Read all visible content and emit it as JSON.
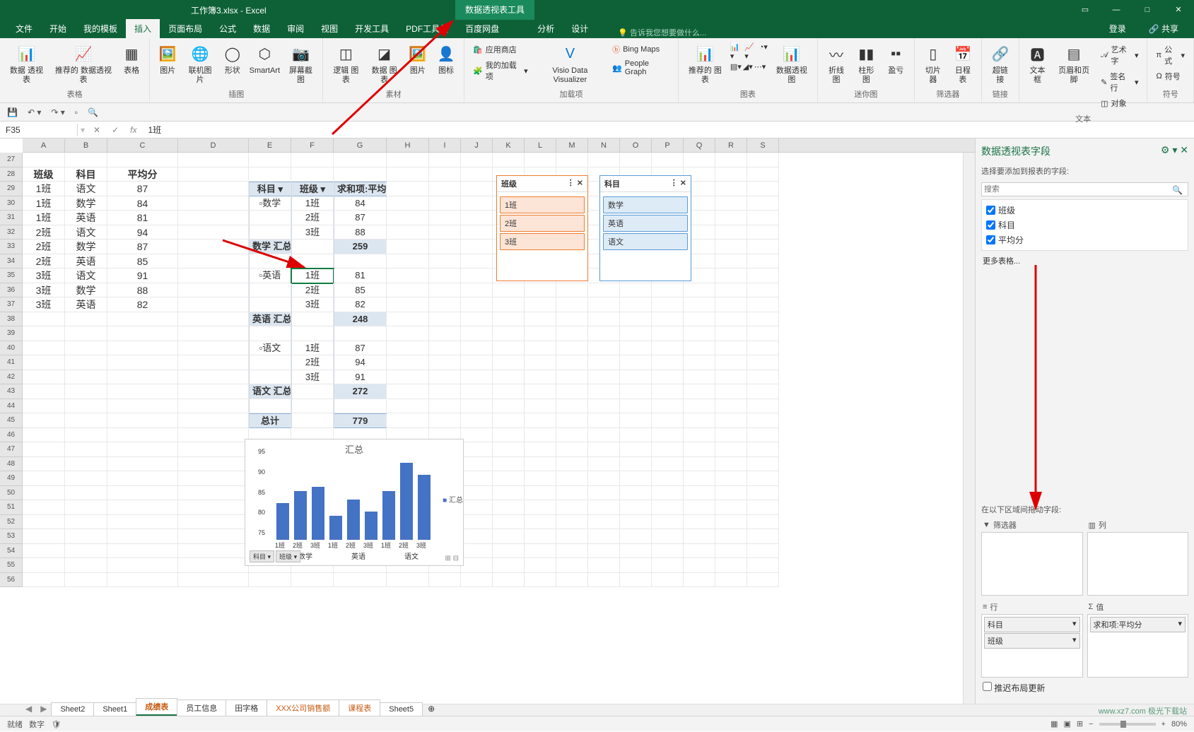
{
  "title_bar": {
    "doc": "工作簿3.xlsx - Excel",
    "context_tab": "数据透视表工具"
  },
  "win_controls": {
    "ribbon_opts": "▭",
    "min": "—",
    "max": "□",
    "close": "✕"
  },
  "tabs": {
    "file": "文件",
    "home": "开始",
    "templates": "我的模板",
    "insert": "插入",
    "layout": "页面布局",
    "formulas": "公式",
    "data": "数据",
    "review": "审阅",
    "view": "视图",
    "dev": "开发工具",
    "pdf": "PDF工具集",
    "baidu": "百度网盘",
    "analyze": "分析",
    "design": "设计",
    "tell": "告诉我您想要做什么...",
    "login": "登录",
    "share": "共享"
  },
  "ribbon": {
    "tables": {
      "pivot": "数据\n透视表",
      "rec_pivot": "推荐的\n数据透视表",
      "table": "表格",
      "label": "表格"
    },
    "illus": {
      "pic": "图片",
      "online": "联机图片",
      "shapes": "形状",
      "smartart": "SmartArt",
      "screenshot": "屏幕截图",
      "label": "插图"
    },
    "charts": {
      "reccharts": "推荐的\n图表",
      "pivotchart": "数据透视图",
      "label": "图表"
    },
    "addins": {
      "store": "应用商店",
      "myaddins": "我的加载项",
      "vdv": "Visio Data\nVisualizer",
      "bing": "Bing Maps",
      "pgraph": "People Graph",
      "label": "加载项"
    },
    "sparkline": {
      "line": "折线图",
      "col": "柱形图",
      "winloss": "盈亏",
      "label": "迷你图"
    },
    "filters": {
      "slicer": "切片器",
      "timeline": "日程表",
      "label": "筛选器"
    },
    "links": {
      "link": "超链接",
      "label": "链接"
    },
    "text": {
      "tbox": "文本框",
      "hdrftr": "页眉和页脚",
      "wordart": "艺术字",
      "sig": "签名行",
      "obj": "对象",
      "label": "文本"
    },
    "symbols": {
      "eq": "公式",
      "sym": "符号",
      "label": "符号"
    },
    "logic": {
      "logicmodel": "逻辑\n图表",
      "datamodel": "数据\n图表",
      "pic2": "图片",
      "icons": "图标",
      "label": "素材"
    }
  },
  "namebox": "F35",
  "formula": "1班",
  "cols": [
    "A",
    "B",
    "C",
    "D",
    "E",
    "F",
    "G",
    "H",
    "I",
    "J",
    "K",
    "L",
    "M",
    "N",
    "O",
    "P",
    "Q",
    "R",
    "S"
  ],
  "row_start": 27,
  "row_end": 56,
  "source_table": {
    "headers": {
      "class": "班级",
      "subject": "科目",
      "avg": "平均分"
    },
    "rows": [
      {
        "c": "1班",
        "s": "语文",
        "v": "87"
      },
      {
        "c": "1班",
        "s": "数学",
        "v": "84"
      },
      {
        "c": "1班",
        "s": "英语",
        "v": "81"
      },
      {
        "c": "2班",
        "s": "语文",
        "v": "94"
      },
      {
        "c": "2班",
        "s": "数学",
        "v": "87"
      },
      {
        "c": "2班",
        "s": "英语",
        "v": "85"
      },
      {
        "c": "3班",
        "s": "语文",
        "v": "91"
      },
      {
        "c": "3班",
        "s": "数学",
        "v": "88"
      },
      {
        "c": "3班",
        "s": "英语",
        "v": "82"
      }
    ]
  },
  "pivot": {
    "hdr_subject": "科目",
    "hdr_class": "班级",
    "hdr_sum": "求和项:平均分",
    "groups": [
      {
        "subj": "数学",
        "rows": [
          {
            "c": "1班",
            "v": "84"
          },
          {
            "c": "2班",
            "v": "87"
          },
          {
            "c": "3班",
            "v": "88"
          }
        ],
        "subtotal_lbl": "数学 汇总",
        "subtotal": "259"
      },
      {
        "subj": "英语",
        "rows": [
          {
            "c": "1班",
            "v": "81"
          },
          {
            "c": "2班",
            "v": "85"
          },
          {
            "c": "3班",
            "v": "82"
          }
        ],
        "subtotal_lbl": "英语 汇总",
        "subtotal": "248"
      },
      {
        "subj": "语文",
        "rows": [
          {
            "c": "1班",
            "v": "87"
          },
          {
            "c": "2班",
            "v": "94"
          },
          {
            "c": "3班",
            "v": "91"
          }
        ],
        "subtotal_lbl": "语文 汇总",
        "subtotal": "272"
      }
    ],
    "grand_lbl": "总计",
    "grand": "779",
    "collapse": "▫"
  },
  "slicer_class": {
    "title": "班级",
    "items": [
      "1班",
      "2班",
      "3班"
    ]
  },
  "slicer_subject": {
    "title": "科目",
    "items": [
      "数学",
      "英语",
      "语文"
    ]
  },
  "chart_data": {
    "type": "bar",
    "title": "汇总",
    "categories": [
      "1班",
      "2班",
      "3班",
      "1班",
      "2班",
      "3班",
      "1班",
      "2班",
      "3班"
    ],
    "groups": [
      "数学",
      "英语",
      "语文"
    ],
    "values": [
      84,
      87,
      88,
      81,
      85,
      82,
      87,
      94,
      91
    ],
    "min": 75,
    "max": 95,
    "ticks": [
      75,
      80,
      85,
      90,
      95
    ],
    "legend": "汇总",
    "color": "#4472c4",
    "filter_labels": [
      "科目",
      "班级"
    ]
  },
  "sheets": [
    "Sheet2",
    "Sheet1",
    "成绩表",
    "员工信息",
    "田字格",
    "XXX公司销售额",
    "课程表",
    "Sheet5"
  ],
  "active_sheet": "成绩表",
  "field_panel": {
    "title": "数据透视表字段",
    "subtitle": "选择要添加到报表的字段:",
    "search": "搜索",
    "fields": [
      "班级",
      "科目",
      "平均分"
    ],
    "more": "更多表格...",
    "drag_hint": "在以下区域间拖动字段:",
    "zone_filter": "筛选器",
    "zone_cols": "列",
    "zone_rows": "行",
    "zone_vals": "值",
    "row_items": [
      "科目",
      "班级"
    ],
    "val_items": [
      "求和项:平均分"
    ],
    "defer": "推迟布局更新"
  },
  "statusbar": {
    "ready": "就绪",
    "mode": "数字",
    "zoom": "80%"
  },
  "watermark": "www.xz7.com 极光下载站"
}
